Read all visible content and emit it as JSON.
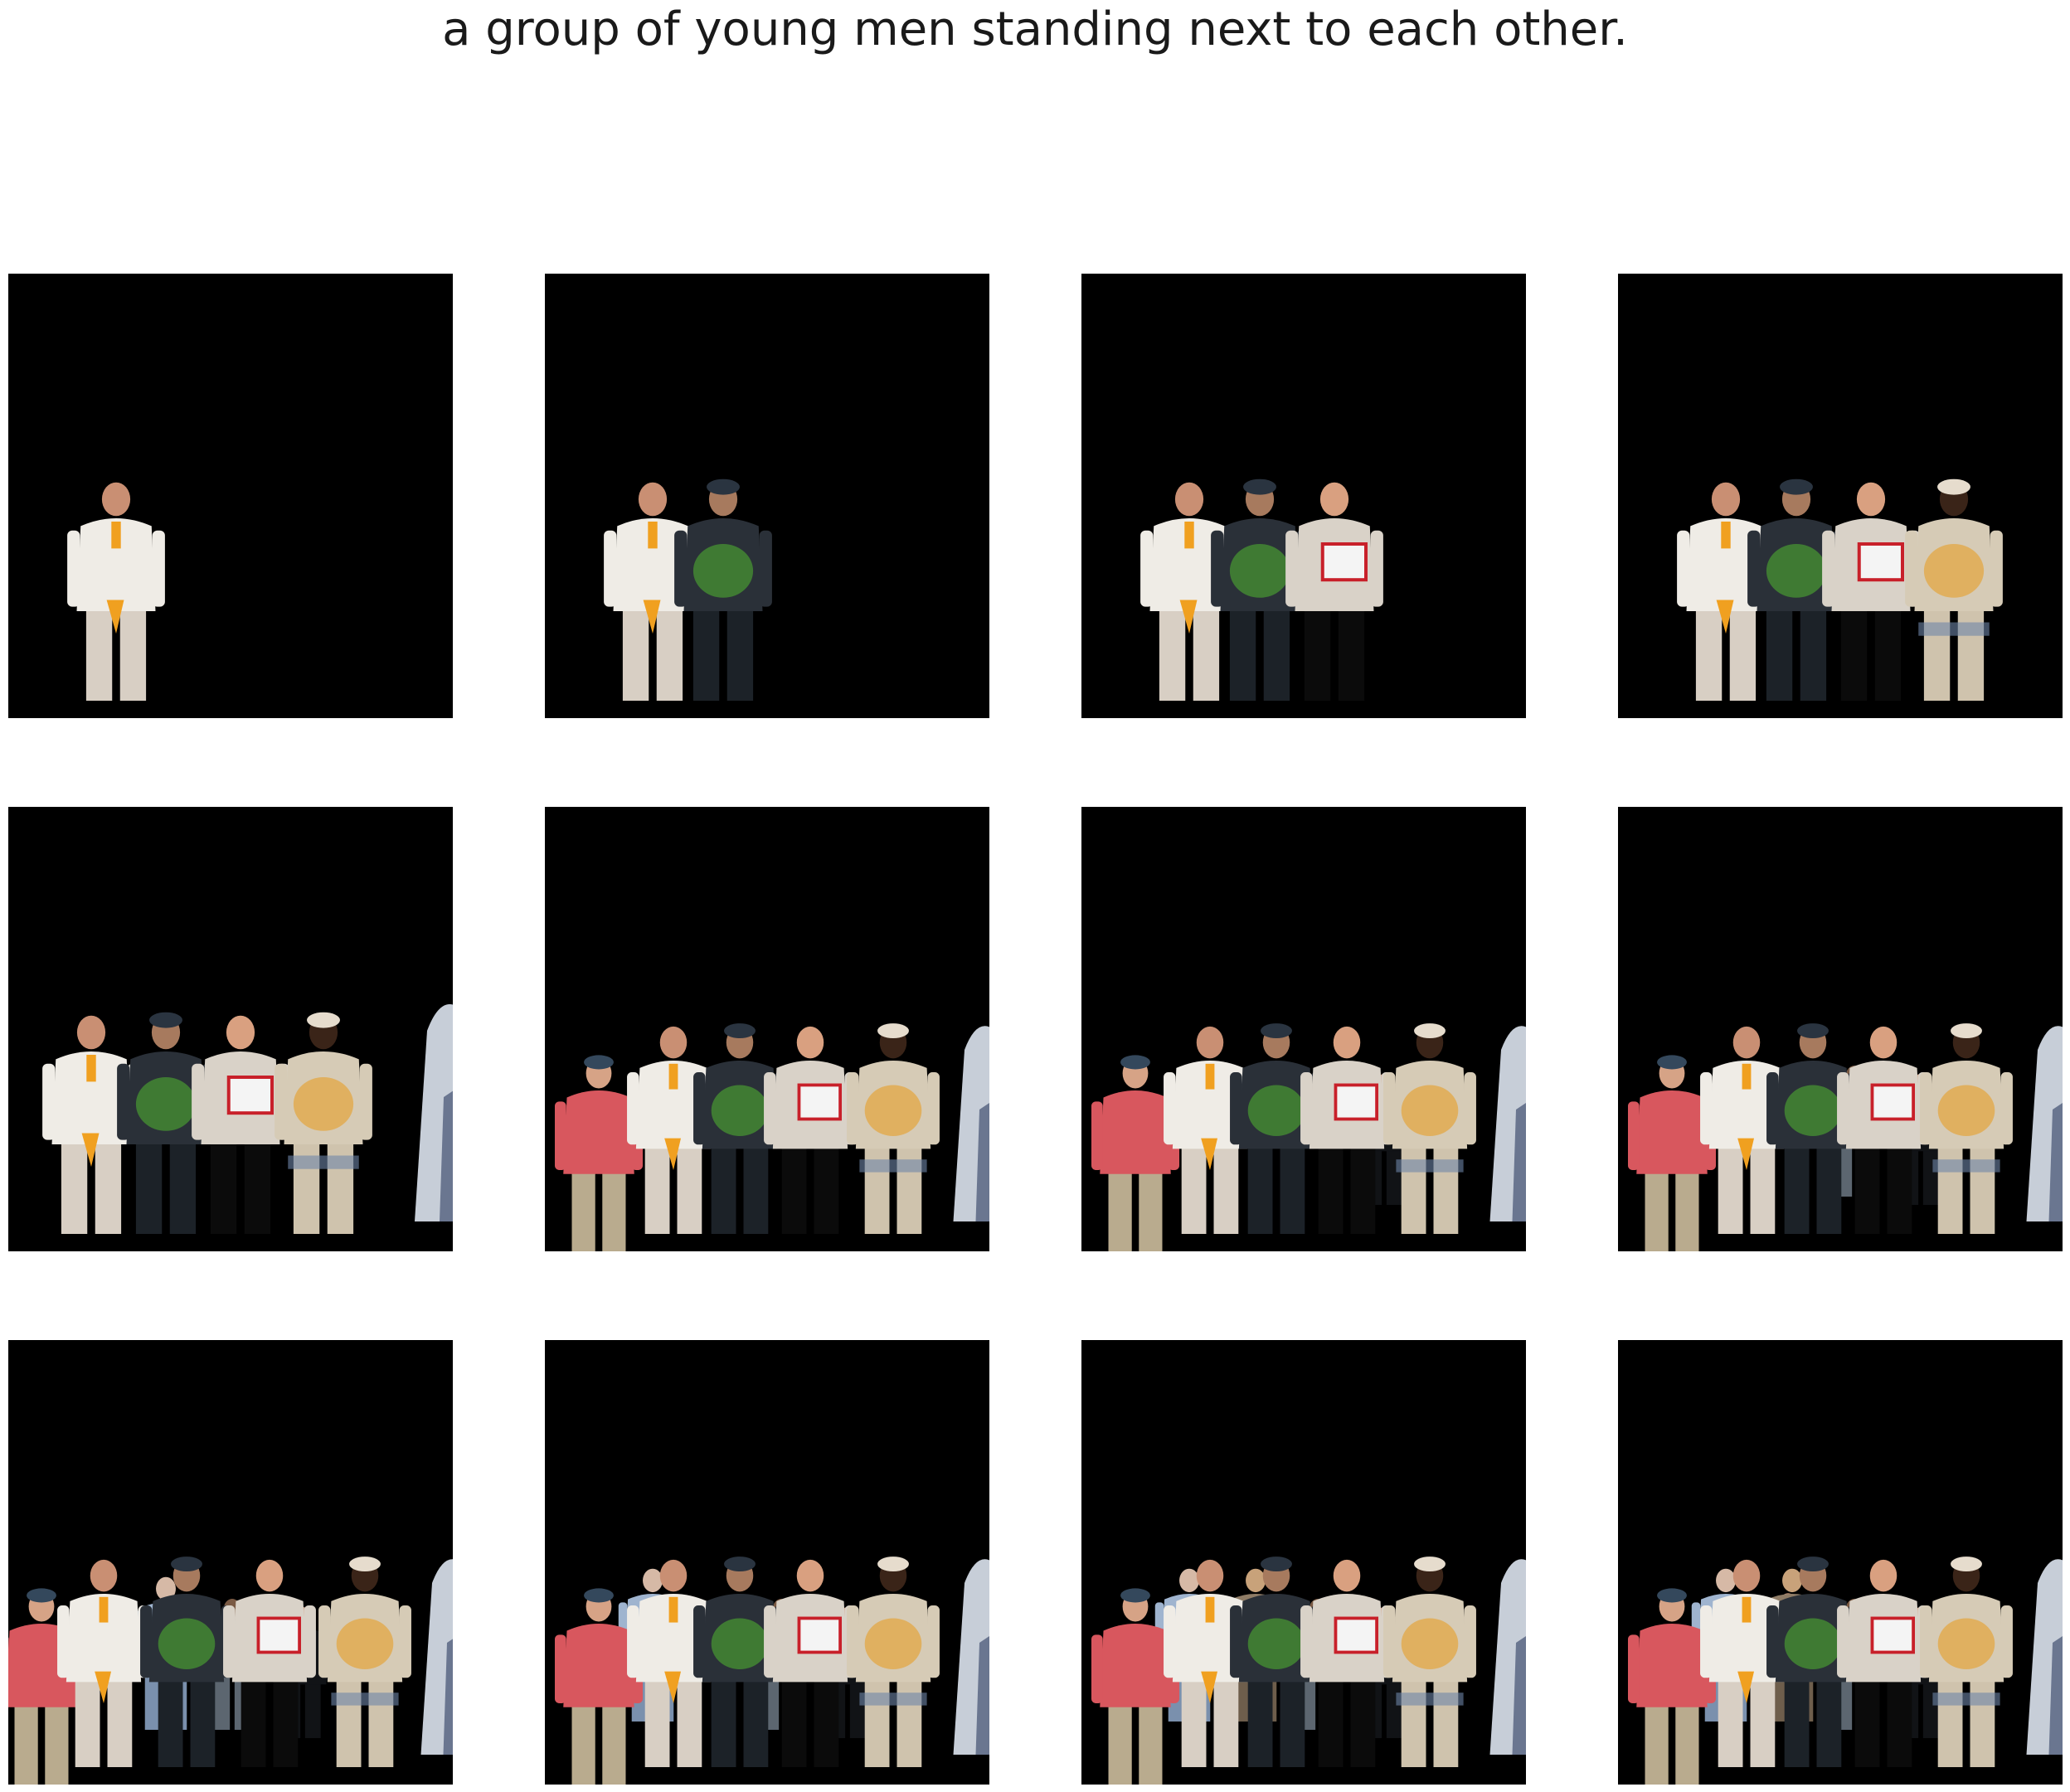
{
  "caption": "a group of young men standing next to each other.",
  "grid": {
    "rows": 3,
    "cols": 4,
    "panel_background": "#000000",
    "page_background": "#ffffff"
  },
  "cutout_sequence": [
    "man-white-shirt-sunglasses",
    "man-dark-jacket-holding-greens",
    "man-holding-whiteboard-sign",
    "woman-patterned-dress-headwrap",
    "partial-figure-right-edge",
    "man-red-shirt-cap",
    "man-dark-suit",
    "man-back-turned",
    "woman-blue-top",
    "person-tan-head",
    "man-dark-suit-background"
  ],
  "frames": [
    {
      "figures": 1,
      "layout": "a"
    },
    {
      "figures": 2,
      "layout": "a"
    },
    {
      "figures": 3,
      "layout": "a"
    },
    {
      "figures": 4,
      "layout": "a"
    },
    {
      "figures": 5,
      "layout": "b"
    },
    {
      "figures": 6,
      "layout": "c"
    },
    {
      "figures": 7,
      "layout": "c"
    },
    {
      "figures": 8,
      "layout": "c"
    },
    {
      "figures": 9,
      "layout": "d"
    },
    {
      "figures": 9,
      "layout": "c"
    },
    {
      "figures": 10,
      "layout": "c"
    },
    {
      "figures": 11,
      "layout": "c"
    }
  ]
}
